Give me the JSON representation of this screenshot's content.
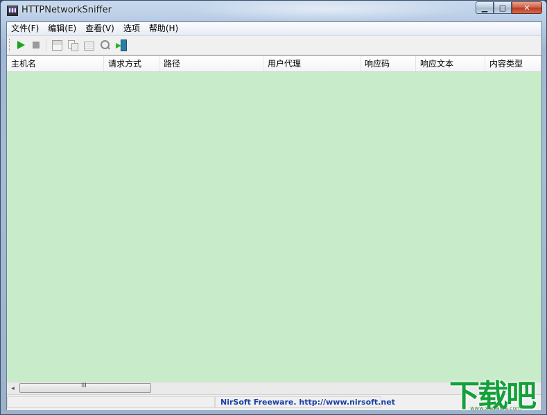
{
  "window": {
    "title": "HTTPNetworkSniffer",
    "caption_buttons": {
      "minimize": "▁",
      "maximize": "□",
      "close": "✕"
    }
  },
  "menubar": {
    "items": [
      {
        "label": "文件(F)"
      },
      {
        "label": "编辑(E)"
      },
      {
        "label": "查看(V)"
      },
      {
        "label": "选项"
      },
      {
        "label": "帮助(H)"
      }
    ]
  },
  "toolbar": {
    "buttons": [
      {
        "icon": "play-icon",
        "enabled": true,
        "color": "#1aa31a"
      },
      {
        "icon": "stop-icon",
        "enabled": false
      },
      {
        "icon": "save-icon",
        "enabled": false
      },
      {
        "icon": "copy-icon",
        "enabled": false
      },
      {
        "icon": "properties-icon",
        "enabled": false
      },
      {
        "icon": "find-icon",
        "enabled": false
      },
      {
        "icon": "exit-icon",
        "enabled": true
      }
    ]
  },
  "listview": {
    "background": "#c8ecca",
    "columns": [
      {
        "label": "主机名"
      },
      {
        "label": "请求方式"
      },
      {
        "label": "路径"
      },
      {
        "label": "用户代理"
      },
      {
        "label": "响应码"
      },
      {
        "label": "响应文本"
      },
      {
        "label": "内容类型"
      }
    ],
    "rows": []
  },
  "scrollbar": {
    "thumb_grip": "III",
    "left_arrow": "◂"
  },
  "statusbar": {
    "link_text": "NirSoft Freeware.  http://www.nirsoft.net",
    "link_color": "#1a3fa6"
  },
  "watermark": {
    "logo_text": "下载吧",
    "url_text": "www.xiazaiba.com"
  }
}
